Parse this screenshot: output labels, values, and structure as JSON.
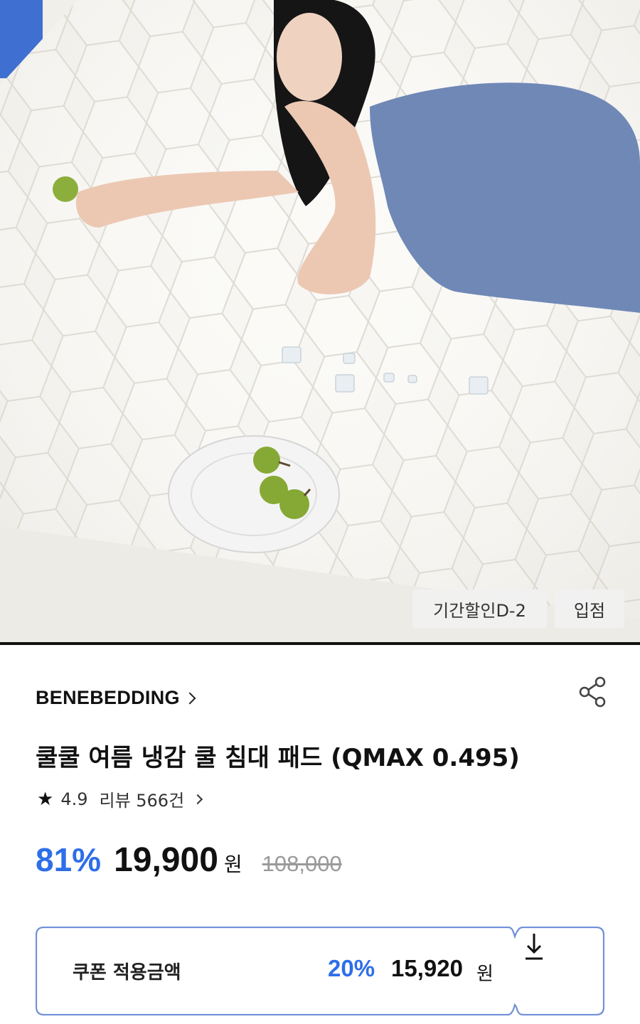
{
  "hero": {
    "image_description": "product-photo-woman-lying-on-quilted-cooling-bed-pad",
    "badges": {
      "period_discount": "기간할인D-2",
      "entry": "입점"
    }
  },
  "product": {
    "brand": "BENEBEDDING",
    "title": "쿨쿨 여름 냉감 쿨 침대 패드 (QMAX 0.495)",
    "rating": "4.9",
    "review_label": "리뷰 566건",
    "discount_rate": "81%",
    "price": "19,900",
    "currency": "원",
    "original_price": "108,000"
  },
  "coupon": {
    "label": "쿠폰 적용금액",
    "discount_rate": "20%",
    "price": "15,920",
    "currency": "원"
  },
  "colors": {
    "accent_blue": "#2e6ee8",
    "coupon_border": "#6f8fd8",
    "text_dark": "#111111",
    "text_muted": "#9a9a9a"
  },
  "icons": [
    "share-icon",
    "chevron-right-icon",
    "star-icon",
    "download-arrow-icon"
  ]
}
